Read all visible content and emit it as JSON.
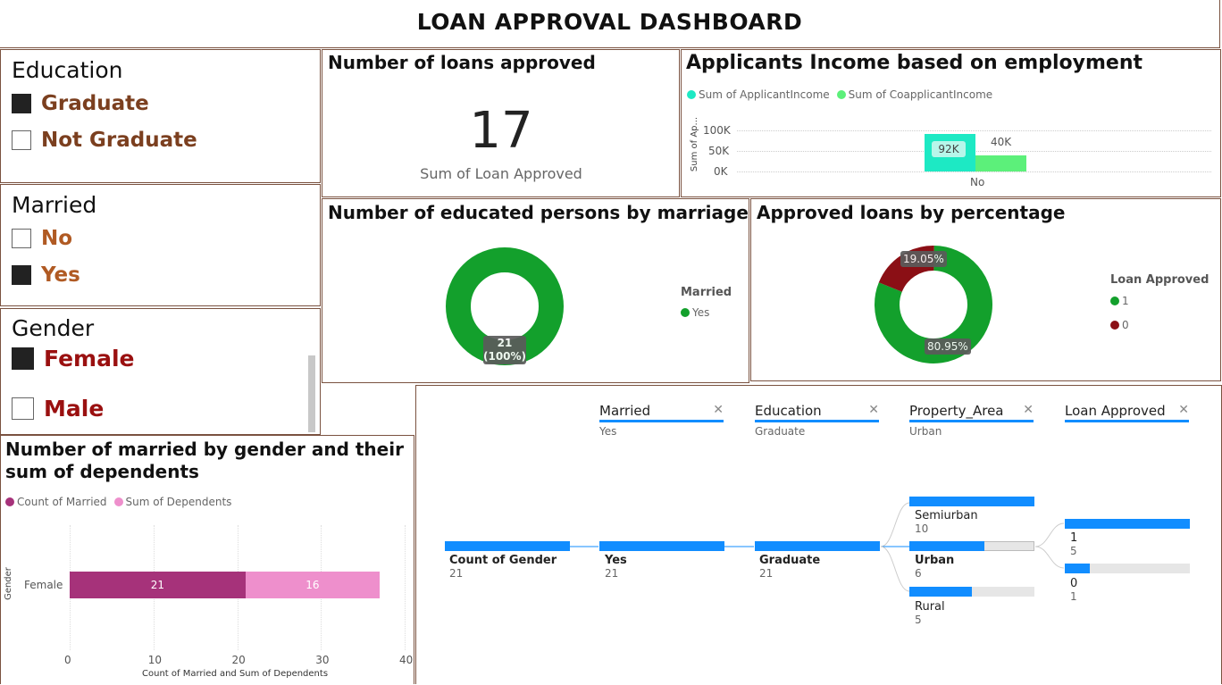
{
  "title": "LOAN APPROVAL DASHBOARD",
  "slicers": {
    "education": {
      "title": "Education",
      "items": [
        {
          "label": "Graduate",
          "checked": true
        },
        {
          "label": "Not Graduate",
          "checked": false
        }
      ],
      "color": "#7b3f1f"
    },
    "married": {
      "title": "Married",
      "items": [
        {
          "label": "No",
          "checked": false
        },
        {
          "label": "Yes",
          "checked": true
        }
      ],
      "color": "#b05a23"
    },
    "gender": {
      "title": "Gender",
      "items": [
        {
          "label": "Female",
          "checked": true
        },
        {
          "label": "Male",
          "checked": false
        }
      ],
      "color": "#9a1010"
    }
  },
  "kpi": {
    "title": "Number of loans approved",
    "value": "17",
    "caption": "Sum of Loan Approved"
  },
  "income": {
    "title": "Applicants Income based on employment",
    "legend": [
      "Sum of ApplicantIncome",
      "Sum of CoapplicantIncome"
    ],
    "ylabel": "Sum of Ap...",
    "yticks": [
      "100K",
      "50K",
      "0K"
    ],
    "category": "No",
    "labels": [
      "92K",
      "40K"
    ]
  },
  "marriage_donut": {
    "title": "Number of educated persons by marriage",
    "legend_title": "Married",
    "legend_item": "Yes",
    "label_value": "21",
    "label_pct": "(100%)"
  },
  "approved_donut": {
    "title": "Approved loans by percentage",
    "legend_title": "Loan Approved",
    "legend_items": [
      "1",
      "0"
    ],
    "label_big": "80.95%",
    "label_small": "19.05%"
  },
  "gender_chart": {
    "title": "Number of married by gender and their sum of dependents",
    "legend": [
      "Count of Married",
      "Sum of Dependents"
    ],
    "ylabel": "Gender",
    "category": "Female",
    "xticks": [
      "0",
      "10",
      "20",
      "30",
      "40"
    ],
    "xlabel": "Count of Married and Sum of Dependents",
    "bar_labels": [
      "21",
      "16"
    ]
  },
  "tree": {
    "levels": [
      {
        "name": "Married",
        "value": "Yes"
      },
      {
        "name": "Education",
        "value": "Graduate"
      },
      {
        "name": "Property_Area",
        "value": "Urban"
      },
      {
        "name": "Loan Approved",
        "value": ""
      }
    ],
    "root": {
      "label": "Count of Gender",
      "value": "21"
    },
    "married": {
      "label": "Yes",
      "value": "21"
    },
    "education": {
      "label": "Graduate",
      "value": "21"
    },
    "areas": [
      {
        "label": "Semiurban",
        "value": "10"
      },
      {
        "label": "Urban",
        "value": "6"
      },
      {
        "label": "Rural",
        "value": "5"
      }
    ],
    "approved": [
      {
        "label": "1",
        "value": "5"
      },
      {
        "label": "0",
        "value": "1"
      }
    ]
  },
  "chart_data": [
    {
      "type": "bar",
      "title": "Applicants Income based on employment",
      "categories": [
        "No"
      ],
      "series": [
        {
          "name": "Sum of ApplicantIncome",
          "values": [
            92000
          ]
        },
        {
          "name": "Sum of CoapplicantIncome",
          "values": [
            40000
          ]
        }
      ],
      "ylim": [
        0,
        100000
      ],
      "colors": [
        "#1de9c4",
        "#5cf07a"
      ]
    },
    {
      "type": "pie",
      "title": "Number of educated persons by marriage",
      "categories": [
        "Yes"
      ],
      "values": [
        21
      ],
      "colors": [
        "#13a02c"
      ]
    },
    {
      "type": "pie",
      "title": "Approved loans by percentage",
      "categories": [
        "1",
        "0"
      ],
      "values": [
        80.95,
        19.05
      ],
      "colors": [
        "#13a02c",
        "#8b0f15"
      ]
    },
    {
      "type": "bar",
      "title": "Number of married by gender and their sum of dependents",
      "categories": [
        "Female"
      ],
      "series": [
        {
          "name": "Count of Married",
          "values": [
            21
          ]
        },
        {
          "name": "Sum of Dependents",
          "values": [
            16
          ]
        }
      ],
      "xlim": [
        0,
        40
      ],
      "colors": [
        "#a6327a",
        "#ee8fcc"
      ]
    }
  ]
}
